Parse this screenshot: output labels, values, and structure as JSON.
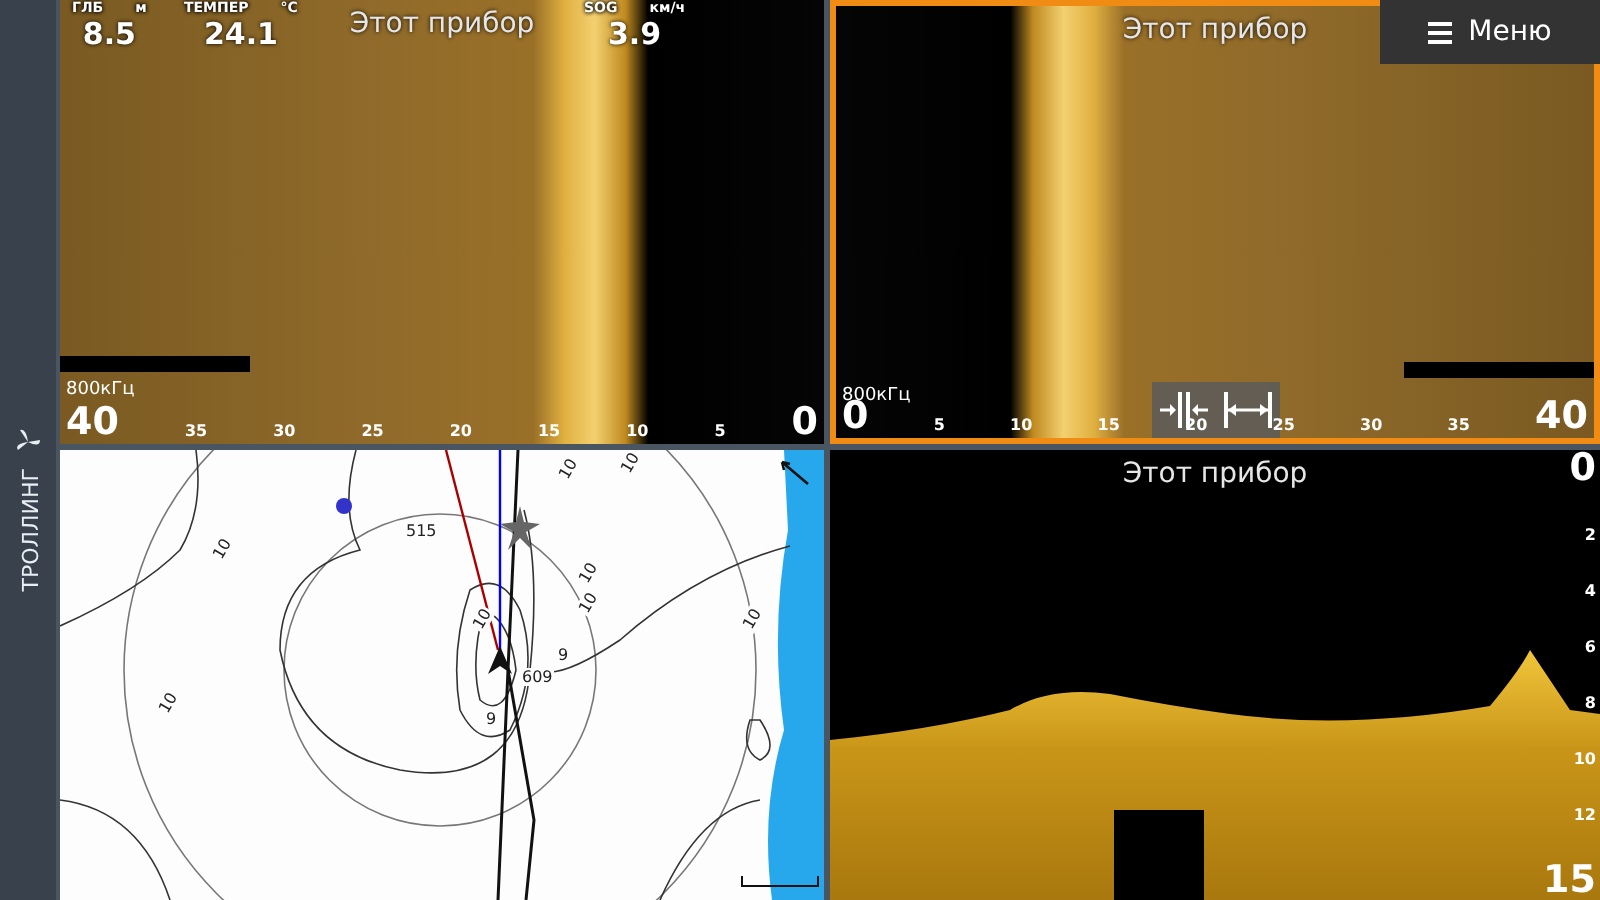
{
  "sidebar": {
    "mode_label": "ТРОЛЛИНГ"
  },
  "menu_button": {
    "label": "Меню"
  },
  "panes": [
    {
      "kind": "leftscan",
      "selected": false,
      "source": "Этот прибор",
      "frequency": "800кГц",
      "range_labels": [
        "40",
        "35",
        "30",
        "25",
        "20",
        "15",
        "10",
        "5",
        "0"
      ],
      "data_fields": [
        {
          "label": "ГЛБ",
          "unit": "м",
          "value": "8.5"
        },
        {
          "label": "ТЕМПЕР",
          "unit": "°C",
          "value": "24.1"
        },
        {
          "label": "SOG",
          "unit": "км/ч",
          "value": "3.9"
        }
      ]
    },
    {
      "kind": "rightscan",
      "selected": true,
      "source": "Этот прибор",
      "frequency": "800кГц",
      "range_labels": [
        "0",
        "5",
        "10",
        "15",
        "20",
        "25",
        "30",
        "35",
        "40"
      ]
    },
    {
      "kind": "chart",
      "selected": false,
      "labels": [
        "10",
        "10",
        "10",
        "10",
        "10",
        "10",
        "10",
        "10",
        "9",
        "9",
        "515",
        "609"
      ]
    },
    {
      "kind": "sonar",
      "selected": false,
      "source": "Этот прибор",
      "depth_labels": [
        "0",
        "2",
        "4",
        "6",
        "8",
        "10",
        "12",
        "15"
      ]
    }
  ]
}
